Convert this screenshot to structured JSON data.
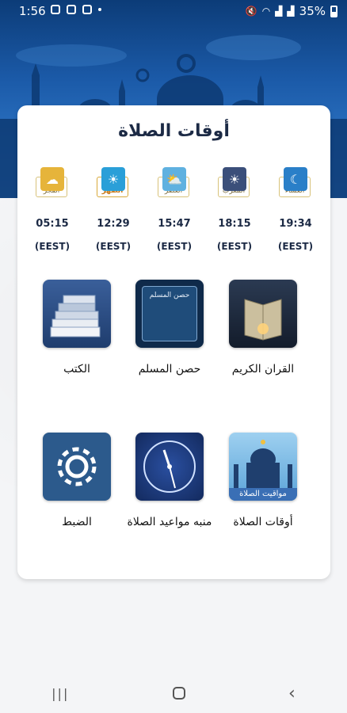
{
  "status": {
    "time": "1:56",
    "battery": "35%"
  },
  "card": {
    "title": "أوقات الصلاة"
  },
  "prayers": [
    {
      "name": "الفجر",
      "time": "05:15",
      "tz": "(EEST)",
      "color": "#e6a93a"
    },
    {
      "name": "الظهر",
      "time": "12:29",
      "tz": "(EEST)",
      "color": "#2a9fd8"
    },
    {
      "name": "العصر",
      "time": "15:47",
      "tz": "(EEST)",
      "color": "#5fb1e0"
    },
    {
      "name": "المغرب",
      "time": "18:15",
      "tz": "(EEST)",
      "color": "#d07a3a"
    },
    {
      "name": "العشاء",
      "time": "19:34",
      "tz": "(EEST)",
      "color": "#1b4e8c"
    }
  ],
  "apps": [
    {
      "label": "الكتب",
      "icon": "books-icon"
    },
    {
      "label": "حصن المسلم",
      "icon": "hisn-book-icon",
      "tile_text": "حصن المسلم"
    },
    {
      "label": "القران الكريم",
      "icon": "quran-icon"
    },
    {
      "label": "الضبط",
      "icon": "gear-icon"
    },
    {
      "label": "منبه مواعيد الصلاة",
      "icon": "clock-icon"
    },
    {
      "label": "أوقات الصلاة",
      "icon": "mosque-icon",
      "tile_text": "مواقيت الصلاة"
    }
  ],
  "colors": {
    "header": "#1b5aa8",
    "title": "#1c2a45",
    "tile_dark": "#2c5a8c"
  }
}
